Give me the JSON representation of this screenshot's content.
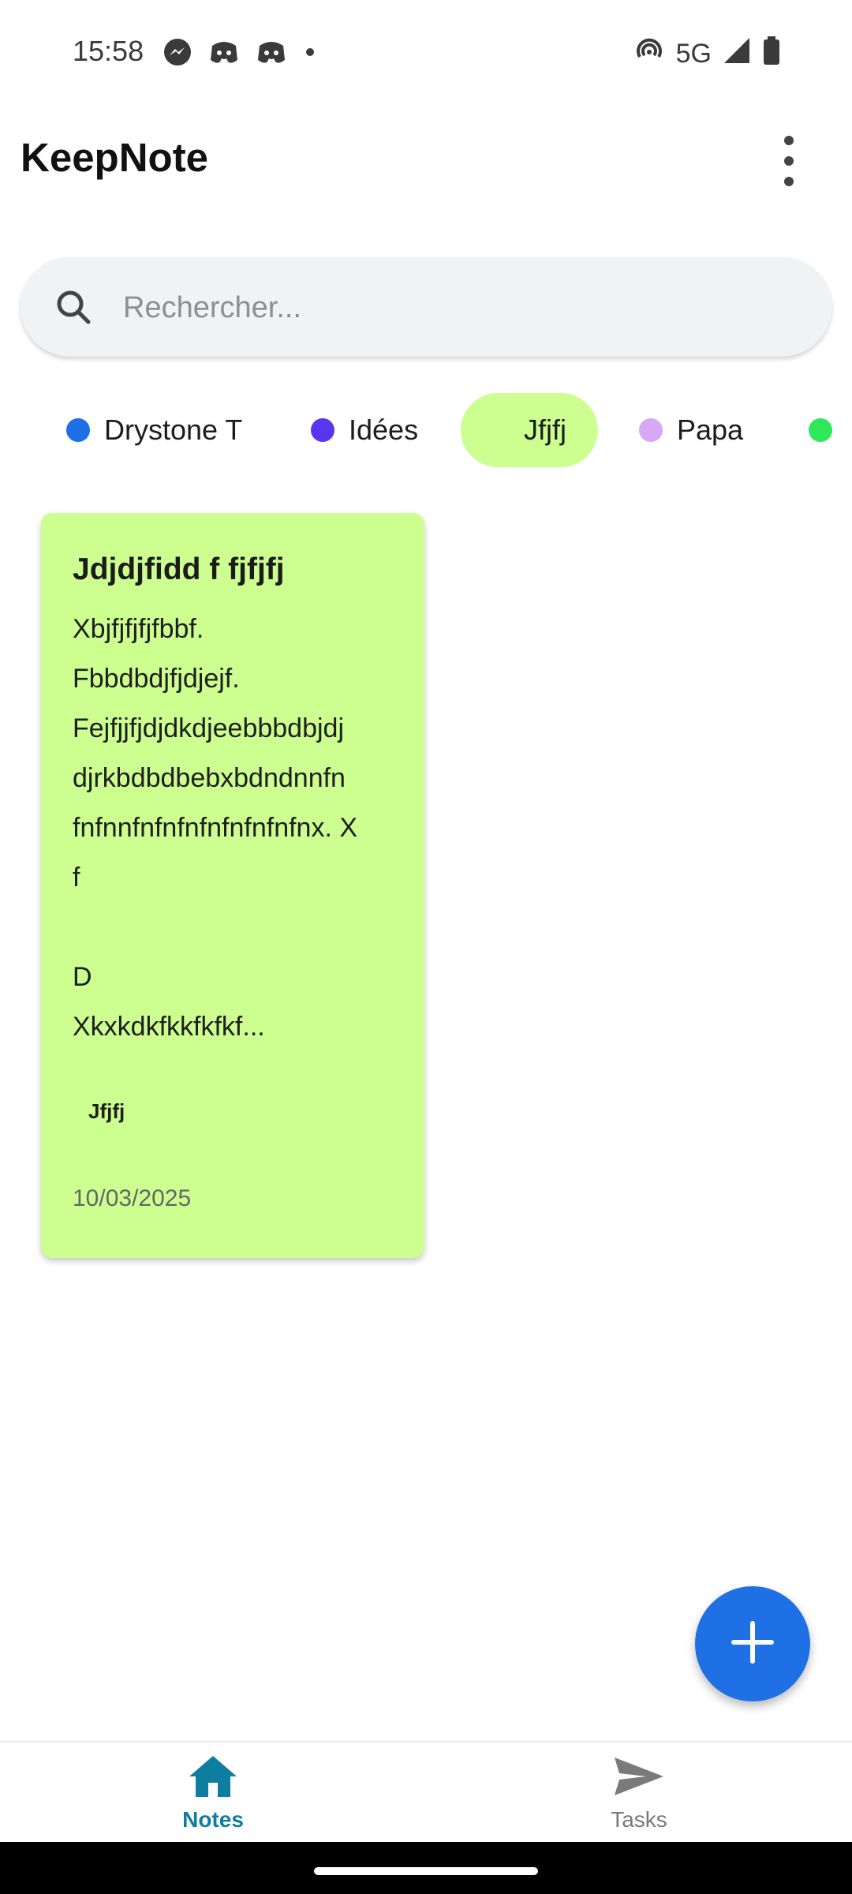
{
  "status_bar": {
    "time": "15:58",
    "network": "5G",
    "left_icons": [
      "messenger-icon",
      "discord-icon",
      "discord-icon",
      "notification-dot-icon"
    ],
    "right_icons": [
      "hotspot-icon",
      "signal-icon",
      "battery-icon"
    ]
  },
  "app": {
    "title": "KeepNote",
    "menu_icon": "more-vert-icon"
  },
  "search": {
    "placeholder": "Rechercher...",
    "value": ""
  },
  "categories": [
    {
      "label": "Drystone T",
      "color": "#1f6fe5",
      "selected": false
    },
    {
      "label": "Idées",
      "color": "#5a35f0",
      "selected": false
    },
    {
      "label": "Jfjfj",
      "color": "#ccff90",
      "selected": true
    },
    {
      "label": "Papa",
      "color": "#d7a8f5",
      "selected": false
    },
    {
      "label": "",
      "color": "#2ee85a",
      "selected": false
    }
  ],
  "notes": [
    {
      "title": "Jdjdjfidd f fjfjfj",
      "body": "Xbjfjfjfjfbbf.\nFbbdbdjfjdjejf.\nFejfjjfjdjdkdjeebbbdbjdj\ndjrkbdbdbebxbdndnnfn\nfnfnnfnfnfnfnfnfnfnfnx. X\nf\n\nD\nXkxkdkfkkfkfkf...",
      "tag": "Jfjfj",
      "date": "10/03/2025",
      "color": "#ccff90"
    }
  ],
  "fab": {
    "icon": "plus-icon",
    "color": "#1f6fe5"
  },
  "bottom_nav": [
    {
      "label": "Notes",
      "icon": "home-icon",
      "active": true,
      "color": "#0d7ea0"
    },
    {
      "label": "Tasks",
      "icon": "send-icon",
      "active": false,
      "color": "#7a7a7a"
    }
  ]
}
